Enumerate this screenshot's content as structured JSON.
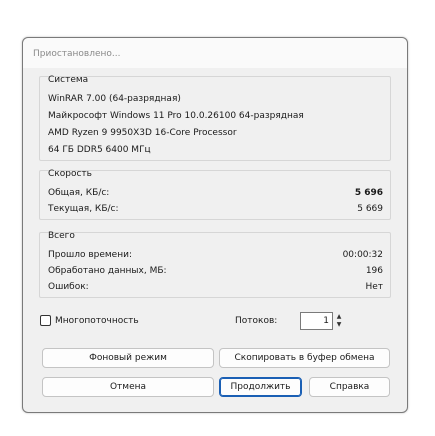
{
  "window": {
    "title": "Приостановлено..."
  },
  "system": {
    "label": "Система",
    "lines": [
      "WinRAR 7.00 (64-разрядная)",
      "Майкрософт Windows 11 Pro 10.0.26100 64-разрядная",
      "AMD Ryzen 9 9950X3D 16-Core Processor",
      "64 ГБ DDR5 6400 МГц"
    ]
  },
  "speed": {
    "label": "Скорость",
    "rows": [
      {
        "label": "Общая, КБ/с:",
        "value": "5 696"
      },
      {
        "label": "Текущая, КБ/с:",
        "value": "5 669"
      }
    ]
  },
  "total": {
    "label": "Всего",
    "rows": [
      {
        "label": "Прошло времени:",
        "value": "00:00:32"
      },
      {
        "label": "Обработано данных, МБ:",
        "value": "196"
      },
      {
        "label": "Ошибок:",
        "value": "Нет"
      }
    ]
  },
  "options": {
    "multithreading_label": "Многопоточность",
    "multithreading_checked": false,
    "threads_label": "Потоков:",
    "threads_value": "1"
  },
  "buttons": {
    "background": "Фоновый режим",
    "copy": "Скопировать в буфер обмена",
    "cancel": "Отмена",
    "resume": "Продолжить",
    "help": "Справка"
  },
  "colors": {
    "accent": "#1a5fb4",
    "title_text": "#8a8a8a"
  }
}
